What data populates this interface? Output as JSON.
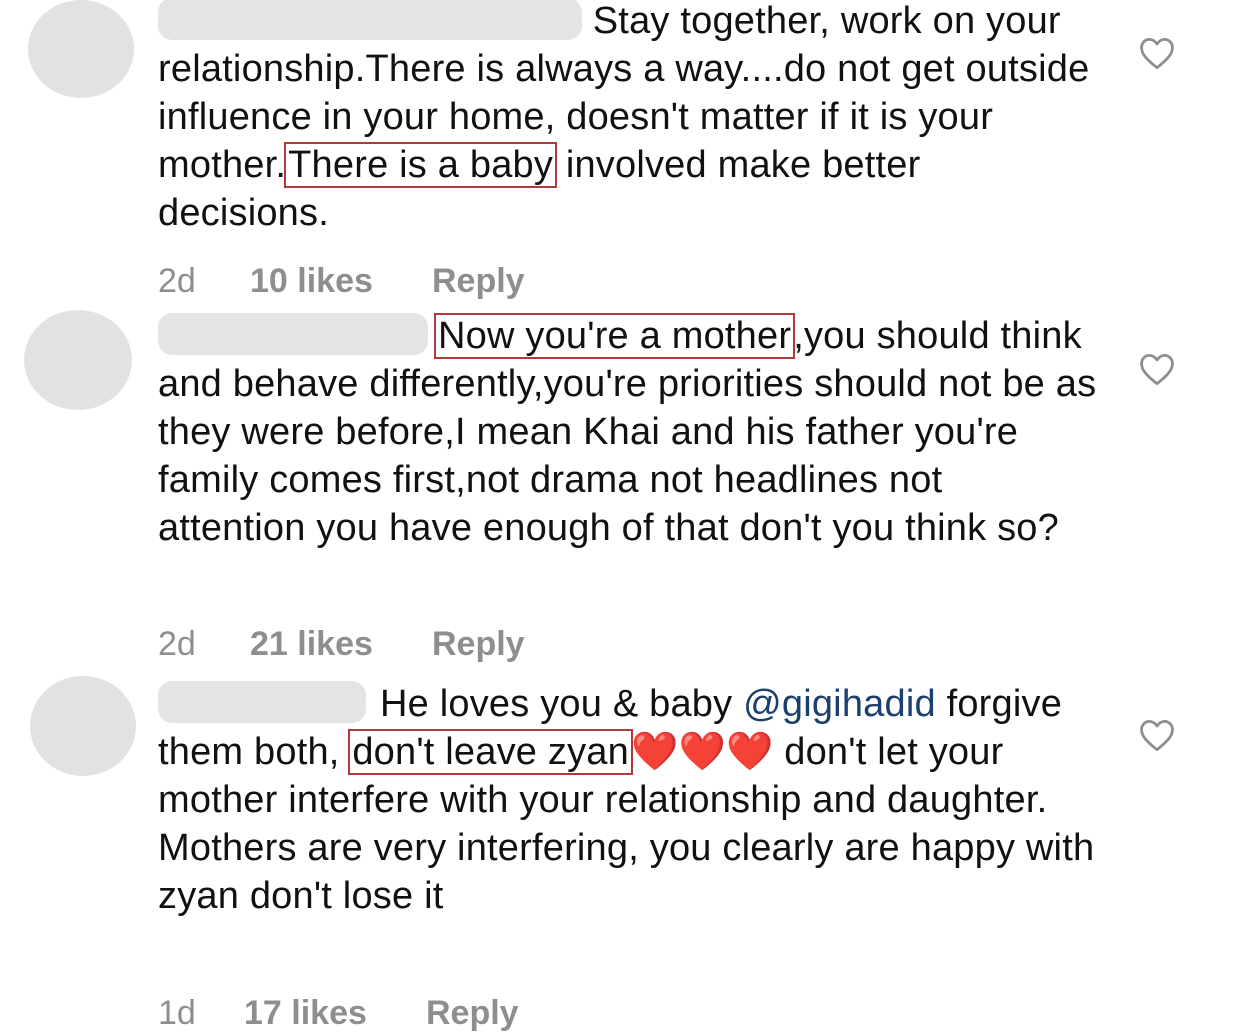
{
  "comments": [
    {
      "text_part1": "Stay together, work on your relationship.There is always a way....do not get outside influence in your home, doesn't matter if it is your mother.",
      "highlight": "There is a baby",
      "text_part2": " involved make better decisions.",
      "age": "2d",
      "likes": "10 likes",
      "reply": "Reply"
    },
    {
      "text_part1": "",
      "highlight": "Now you're a mother",
      "text_part2": ",you should think and behave differently,you're priorities should not be as they were before,I mean Khai and his father you're family comes first,not drama not headlines not attention you have enough of that don't you think so?",
      "age": "2d",
      "likes": "21 likes",
      "reply": "Reply"
    },
    {
      "text_part1": "He loves you & baby ",
      "mention": "@gigihadid",
      "text_part1b": " forgive them both, ",
      "highlight": "don't leave zyan",
      "hearts": "❤️❤️❤️",
      "text_part2": " don't let your mother interfere with your relationship and daughter. Mothers are very interfering, you clearly are happy with zyan don't lose it",
      "age": "1d",
      "likes": "17 likes",
      "reply": "Reply"
    }
  ],
  "icons": {
    "like": "heart-outline-icon"
  },
  "colors": {
    "highlight_border": "#b03a3a",
    "mention": "#1d3f6f",
    "meta_text": "#8e8e8e",
    "avatar": "#e2e2e2"
  }
}
